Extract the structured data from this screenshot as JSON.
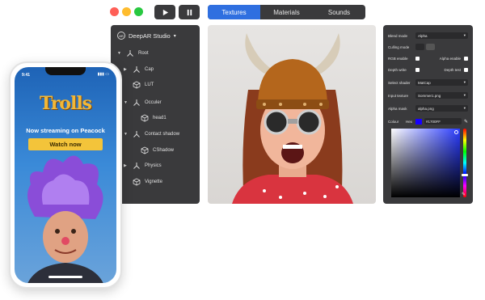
{
  "window": {
    "dots": [
      "#ff5f57",
      "#febc2e",
      "#28c840"
    ]
  },
  "toolbar": {
    "play_icon": "play-icon",
    "pause_icon": "pause-icon"
  },
  "tabs": [
    {
      "label": "Textures",
      "active": true
    },
    {
      "label": "Materials",
      "active": false
    },
    {
      "label": "Sounds",
      "active": false
    }
  ],
  "hierarchy": {
    "title": "DeepAR Studio",
    "nodes": [
      {
        "label": "Root"
      },
      {
        "label": "Cap"
      },
      {
        "label": "LUT"
      },
      {
        "label": "Occuler"
      },
      {
        "label": "head1"
      },
      {
        "label": "Contact shadow"
      },
      {
        "label": "CShadow"
      },
      {
        "label": "Physics"
      },
      {
        "label": "Vignette"
      }
    ]
  },
  "properties": {
    "blend_mode": {
      "label": "Blend mode",
      "value": "Alpha"
    },
    "culling_mode": {
      "label": "Culling mode"
    },
    "rgb_enable": {
      "label": "RGB enable"
    },
    "alpha_enable": {
      "label": "Alpha enable"
    },
    "depth_write": {
      "label": "Depth write"
    },
    "depth_test": {
      "label": "Depth test"
    },
    "select_shader": {
      "label": "Select shader",
      "value": "MatCap"
    },
    "input_texture": {
      "label": "Input texture",
      "value": "Sommer1.png"
    },
    "alpha_mask": {
      "label": "Alpha mask",
      "value": "alpha.png"
    },
    "colour": {
      "label": "Colour",
      "mode": "Hex",
      "hex": "#1700FF"
    }
  },
  "phone": {
    "time": "9:41",
    "brand": "Trolls",
    "headline": "Now streaming on Peacock",
    "cta": "Watch now"
  },
  "colors": {
    "panel": "#3a3a3c",
    "accent": "#2f6fe0",
    "cta": "#f3c43a"
  }
}
